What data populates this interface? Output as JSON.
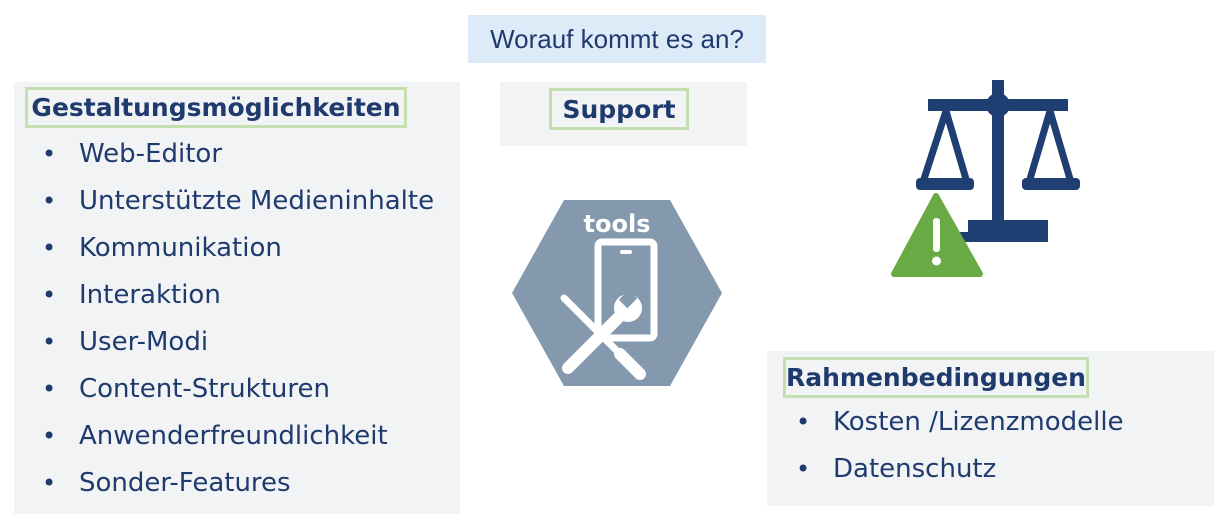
{
  "question": "Worauf kommt es an?",
  "left": {
    "heading": "Gestaltungsmöglichkeiten",
    "items": [
      "Web-Editor",
      "Unterstützte Medieninhalte",
      "Kommunikation",
      "Interaktion",
      "User-Modi",
      "Content-Strukturen",
      "Anwenderfreundlichkeit",
      "Sonder-Features"
    ]
  },
  "middle": {
    "heading": "Support",
    "icon_label": "tools",
    "icon": "phone-tools-icon"
  },
  "right": {
    "heading": "Rahmenbedingungen",
    "items": [
      "Kosten /Lizenzmodelle",
      "Datenschutz"
    ],
    "icon": "scale-warning-icon"
  },
  "bullet": "•",
  "colors": {
    "text": "#1f3b6e",
    "heading_border": "#c4dfb0",
    "panel_bg": "#f2f3f5",
    "question_bg": "#ddeaf8",
    "hexagon": "#8499ad",
    "scale": "#1f3f72",
    "warning": "#6aaa45"
  }
}
